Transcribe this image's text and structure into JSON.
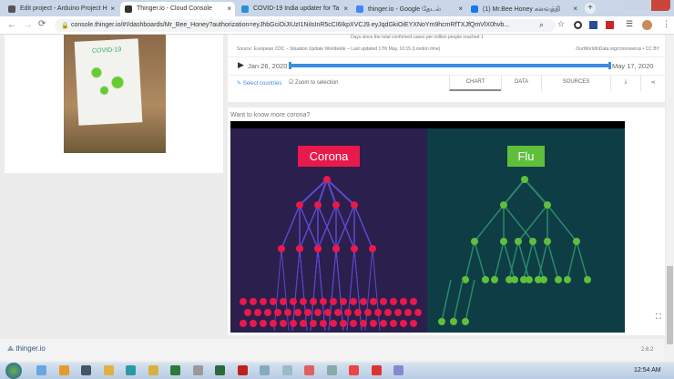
{
  "browser": {
    "tabs": [
      {
        "title": "Edit project - Arduino Project H",
        "color": "#555"
      },
      {
        "title": "Thinger.io - Cloud Console",
        "color": "#333",
        "active": true
      },
      {
        "title": "COVID-19 India updater for Ta",
        "color": "#2d8fd5"
      },
      {
        "title": "thinger.io - Google தேடல்",
        "color": "#4285f4"
      },
      {
        "title": "(1) Mr.Bee Honey கனவுத்தி",
        "color": "#1877f2"
      }
    ],
    "url": "console.thinger.io/#!/dashboards/Mr_Bee_Honey?authorization=eyJhbGciOiJIUzI1NiIsInR5cCI6IkpXVCJ9.eyJqdGkiOiEYXNoYm9hcmRfTXJfQmVlX0hvb..."
  },
  "left_card": {
    "poster_text": "COVID-19"
  },
  "chart": {
    "subtitle": "Days since the total confirmed cases per million people reached 1",
    "source": "Source: European CDC – Situation Update Worldwide – Last updated 17th May, 10:15 (London time)",
    "credit": "OurWorldInData.org/coronavirus • CC BY",
    "start_date": "Jan 26, 2020",
    "end_date": "May 17, 2020",
    "range_fraction": [
      0,
      1
    ],
    "select_countries": "Select countries",
    "zoom_to_selection": "Zoom to selection",
    "tabs": [
      "CHART",
      "DATA",
      "SOURCES"
    ],
    "active_tab": "CHART"
  },
  "video": {
    "label": "Want to know more corona?",
    "left_title": "Corona",
    "right_title": "Flu",
    "accent_left": "#e8194b",
    "accent_right": "#5fbf3a"
  },
  "footer": {
    "logo": "thinger.io",
    "version": "2.6.2"
  },
  "taskbar": {
    "time": "12:54 AM"
  }
}
